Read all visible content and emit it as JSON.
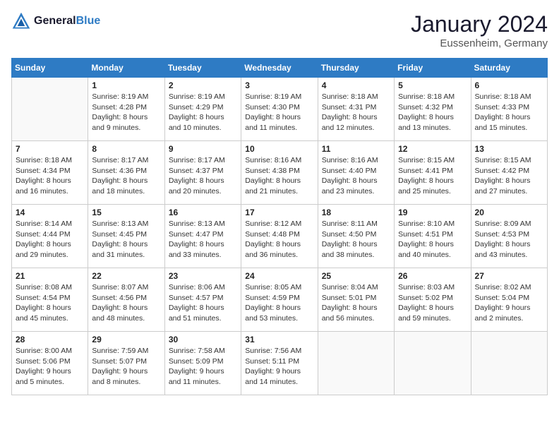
{
  "header": {
    "logo_line1": "General",
    "logo_line2": "Blue",
    "month": "January 2024",
    "location": "Eussenheim, Germany"
  },
  "weekdays": [
    "Sunday",
    "Monday",
    "Tuesday",
    "Wednesday",
    "Thursday",
    "Friday",
    "Saturday"
  ],
  "weeks": [
    [
      {
        "day": "",
        "info": ""
      },
      {
        "day": "1",
        "info": "Sunrise: 8:19 AM\nSunset: 4:28 PM\nDaylight: 8 hours\nand 9 minutes."
      },
      {
        "day": "2",
        "info": "Sunrise: 8:19 AM\nSunset: 4:29 PM\nDaylight: 8 hours\nand 10 minutes."
      },
      {
        "day": "3",
        "info": "Sunrise: 8:19 AM\nSunset: 4:30 PM\nDaylight: 8 hours\nand 11 minutes."
      },
      {
        "day": "4",
        "info": "Sunrise: 8:18 AM\nSunset: 4:31 PM\nDaylight: 8 hours\nand 12 minutes."
      },
      {
        "day": "5",
        "info": "Sunrise: 8:18 AM\nSunset: 4:32 PM\nDaylight: 8 hours\nand 13 minutes."
      },
      {
        "day": "6",
        "info": "Sunrise: 8:18 AM\nSunset: 4:33 PM\nDaylight: 8 hours\nand 15 minutes."
      }
    ],
    [
      {
        "day": "7",
        "info": "Sunrise: 8:18 AM\nSunset: 4:34 PM\nDaylight: 8 hours\nand 16 minutes."
      },
      {
        "day": "8",
        "info": "Sunrise: 8:17 AM\nSunset: 4:36 PM\nDaylight: 8 hours\nand 18 minutes."
      },
      {
        "day": "9",
        "info": "Sunrise: 8:17 AM\nSunset: 4:37 PM\nDaylight: 8 hours\nand 20 minutes."
      },
      {
        "day": "10",
        "info": "Sunrise: 8:16 AM\nSunset: 4:38 PM\nDaylight: 8 hours\nand 21 minutes."
      },
      {
        "day": "11",
        "info": "Sunrise: 8:16 AM\nSunset: 4:40 PM\nDaylight: 8 hours\nand 23 minutes."
      },
      {
        "day": "12",
        "info": "Sunrise: 8:15 AM\nSunset: 4:41 PM\nDaylight: 8 hours\nand 25 minutes."
      },
      {
        "day": "13",
        "info": "Sunrise: 8:15 AM\nSunset: 4:42 PM\nDaylight: 8 hours\nand 27 minutes."
      }
    ],
    [
      {
        "day": "14",
        "info": "Sunrise: 8:14 AM\nSunset: 4:44 PM\nDaylight: 8 hours\nand 29 minutes."
      },
      {
        "day": "15",
        "info": "Sunrise: 8:13 AM\nSunset: 4:45 PM\nDaylight: 8 hours\nand 31 minutes."
      },
      {
        "day": "16",
        "info": "Sunrise: 8:13 AM\nSunset: 4:47 PM\nDaylight: 8 hours\nand 33 minutes."
      },
      {
        "day": "17",
        "info": "Sunrise: 8:12 AM\nSunset: 4:48 PM\nDaylight: 8 hours\nand 36 minutes."
      },
      {
        "day": "18",
        "info": "Sunrise: 8:11 AM\nSunset: 4:50 PM\nDaylight: 8 hours\nand 38 minutes."
      },
      {
        "day": "19",
        "info": "Sunrise: 8:10 AM\nSunset: 4:51 PM\nDaylight: 8 hours\nand 40 minutes."
      },
      {
        "day": "20",
        "info": "Sunrise: 8:09 AM\nSunset: 4:53 PM\nDaylight: 8 hours\nand 43 minutes."
      }
    ],
    [
      {
        "day": "21",
        "info": "Sunrise: 8:08 AM\nSunset: 4:54 PM\nDaylight: 8 hours\nand 45 minutes."
      },
      {
        "day": "22",
        "info": "Sunrise: 8:07 AM\nSunset: 4:56 PM\nDaylight: 8 hours\nand 48 minutes."
      },
      {
        "day": "23",
        "info": "Sunrise: 8:06 AM\nSunset: 4:57 PM\nDaylight: 8 hours\nand 51 minutes."
      },
      {
        "day": "24",
        "info": "Sunrise: 8:05 AM\nSunset: 4:59 PM\nDaylight: 8 hours\nand 53 minutes."
      },
      {
        "day": "25",
        "info": "Sunrise: 8:04 AM\nSunset: 5:01 PM\nDaylight: 8 hours\nand 56 minutes."
      },
      {
        "day": "26",
        "info": "Sunrise: 8:03 AM\nSunset: 5:02 PM\nDaylight: 8 hours\nand 59 minutes."
      },
      {
        "day": "27",
        "info": "Sunrise: 8:02 AM\nSunset: 5:04 PM\nDaylight: 9 hours\nand 2 minutes."
      }
    ],
    [
      {
        "day": "28",
        "info": "Sunrise: 8:00 AM\nSunset: 5:06 PM\nDaylight: 9 hours\nand 5 minutes."
      },
      {
        "day": "29",
        "info": "Sunrise: 7:59 AM\nSunset: 5:07 PM\nDaylight: 9 hours\nand 8 minutes."
      },
      {
        "day": "30",
        "info": "Sunrise: 7:58 AM\nSunset: 5:09 PM\nDaylight: 9 hours\nand 11 minutes."
      },
      {
        "day": "31",
        "info": "Sunrise: 7:56 AM\nSunset: 5:11 PM\nDaylight: 9 hours\nand 14 minutes."
      },
      {
        "day": "",
        "info": ""
      },
      {
        "day": "",
        "info": ""
      },
      {
        "day": "",
        "info": ""
      }
    ]
  ]
}
